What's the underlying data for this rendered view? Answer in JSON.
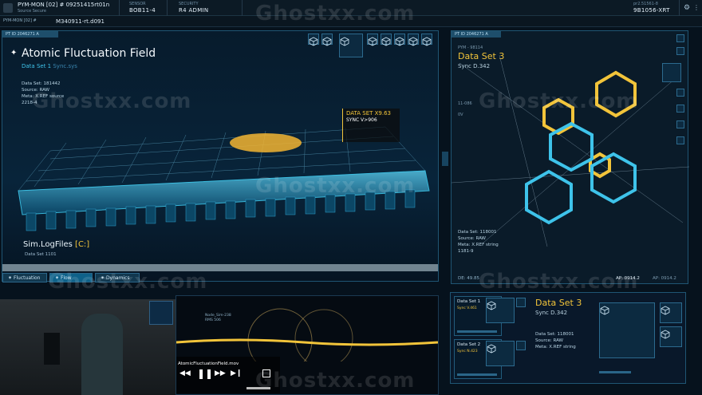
{
  "topbar": {
    "app_title": "PYM-MON [02] # 09251415rt01n",
    "app_sub": "Source Secure",
    "cell1_label": "SENSOR",
    "cell1_value": "BOB11-4",
    "cell2_label": "SECURITY",
    "cell2_value": "R4 ADMIN",
    "right_small": "pr2.51561-8",
    "right_value": "9B1056-XRT"
  },
  "subbar": {
    "left_tab": "PYM-MON [02] #",
    "file_name": "M340911-rt.d091"
  },
  "main_panel": {
    "tab_label": "PT ID 2046271 A",
    "title": "Atomic Fluctuation Field",
    "dataset_label": "Data Set 1",
    "dataset_sync": "Sync.sys",
    "meta_lines": [
      "Data Set: 181442",
      "Source: RAW",
      "Meta: X.REF source",
      "2218-4"
    ],
    "callout_title": "DATA SET X9.63",
    "callout_sync": "SYNC V>906",
    "footer_title": "Sim.LogFiles",
    "footer_bracket": "[C:]",
    "footer_sub": "Data Set 1101",
    "tabs": [
      "Fluctuation",
      "Flow",
      "Dynamics"
    ]
  },
  "right_panel": {
    "tab_label": "PT ID 2046271 A",
    "small_label": "PYM - 98114",
    "title": "Data Set 3",
    "sync": "Sync D.342",
    "side_label1": "11-086",
    "side_label2": "0V",
    "meta_lines": [
      "Data Set: 118001",
      "Source: RAW",
      "Meta: X.REF string",
      "1181-9"
    ],
    "footer_left": "DE: 49.85",
    "footer_right1": "AP: 0914.2",
    "footer_right2": "AP: 0914.2"
  },
  "video": {
    "filename": "AtomicFluctuationField.mov",
    "label1": "Node_Sim-238",
    "label2": "RMS 506"
  },
  "bottom_right": {
    "ds1_label": "Data Set 1",
    "ds1_sync": "Sync V.461",
    "ds2_label": "Data Set 2",
    "ds2_sync": "Sync N.423",
    "title": "Data Set 3",
    "sync": "Sync D.342",
    "meta_lines": [
      "Data Set: 118001",
      "Source: RAW",
      "Meta: X.REF string"
    ]
  },
  "watermark": "Ghostxx.com",
  "colors": {
    "cyan": "#3ec3ea",
    "yellow": "#f2c43a",
    "panel": "#071a2a"
  }
}
